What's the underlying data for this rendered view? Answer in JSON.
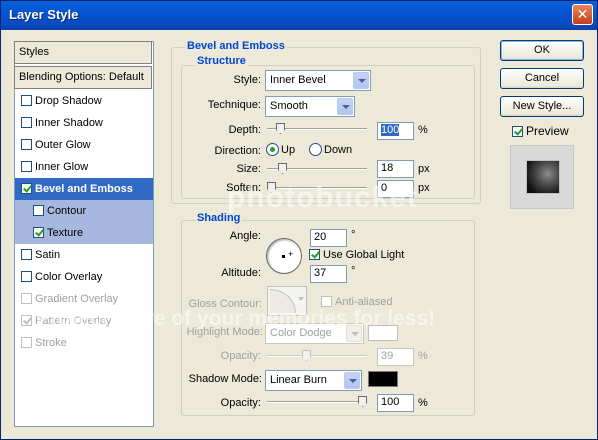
{
  "window": {
    "title": "Layer Style",
    "close_glyph": "✕"
  },
  "left_panel": {
    "styles_header": "Styles",
    "blending_header": "Blending Options: Default",
    "items": [
      {
        "label": "Drop Shadow",
        "checked": false
      },
      {
        "label": "Inner Shadow",
        "checked": false
      },
      {
        "label": "Outer Glow",
        "checked": false
      },
      {
        "label": "Inner Glow",
        "checked": false
      },
      {
        "label": "Bevel and Emboss",
        "checked": true,
        "selected": true
      },
      {
        "label": "Contour",
        "checked": false,
        "sub": true
      },
      {
        "label": "Texture",
        "checked": true,
        "sub": true
      },
      {
        "label": "Satin",
        "checked": false
      },
      {
        "label": "Color Overlay",
        "checked": false
      },
      {
        "label": "Gradient Overlay",
        "checked": false
      },
      {
        "label": "Pattern Overlay",
        "checked": true
      },
      {
        "label": "Stroke",
        "checked": false
      }
    ]
  },
  "bevel": {
    "title": "Bevel and Emboss",
    "structure_title": "Structure",
    "style_label": "Style:",
    "style_value": "Inner Bevel",
    "technique_label": "Technique:",
    "technique_value": "Smooth",
    "depth_label": "Depth:",
    "depth_value": "100",
    "depth_unit": "%",
    "depth_slider": 0.1,
    "direction_label": "Direction:",
    "direction_up": "Up",
    "direction_down": "Down",
    "direction_selected": "Up",
    "size_label": "Size:",
    "size_value": "18",
    "size_unit": "px",
    "size_slider": 0.12,
    "soften_label": "Soften:",
    "soften_value": "0",
    "soften_unit": "px",
    "soften_slider": 0.0
  },
  "shading": {
    "title": "Shading",
    "angle_label": "Angle:",
    "angle_value": "20",
    "angle_unit": "°",
    "global_light_label": "Use Global Light",
    "global_light_checked": true,
    "altitude_label": "Altitude:",
    "altitude_value": "37",
    "altitude_unit": "°",
    "gloss_label": "Gloss Contour:",
    "anti_aliased_label": "Anti-aliased",
    "highlight_mode_label": "Highlight Mode:",
    "highlight_mode_value": "Color Dodge",
    "highlight_color": "#ffffff",
    "highlight_opacity_label": "Opacity:",
    "highlight_opacity_value": "39",
    "highlight_opacity_unit": "%",
    "highlight_opacity_slider": 0.39,
    "shadow_mode_label": "Shadow Mode:",
    "shadow_mode_value": "Linear Burn",
    "shadow_color": "#000000",
    "shadow_opacity_label": "Opacity:",
    "shadow_opacity_value": "100",
    "shadow_opacity_unit": "%",
    "shadow_opacity_slider": 1.0
  },
  "buttons": {
    "ok": "OK",
    "cancel": "Cancel",
    "new_style": "New Style...",
    "preview_label": "Preview",
    "preview_checked": true
  },
  "watermark": {
    "brand": "photobucket",
    "slogan": "Protect more of your memories for less!"
  },
  "colors": {
    "title_bar": "#0a5fd8",
    "selection": "#316ac5",
    "group_label": "#0046d5"
  }
}
